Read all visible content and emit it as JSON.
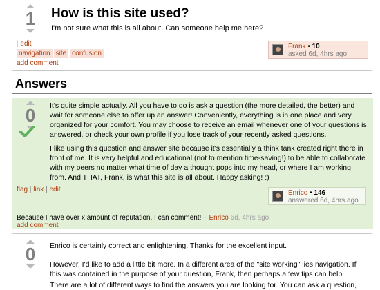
{
  "question": {
    "votes": "1",
    "title": "How is this site used?",
    "body": "I'm not sure what this is all about. Can someone help me here?",
    "menu": {
      "sep": "| ",
      "edit": "edit"
    },
    "tags": [
      "navigation",
      "site",
      "confusion"
    ],
    "add_comment": "add comment",
    "owner": {
      "name": "Frank",
      "dot": " • ",
      "rep": "10",
      "asked": "asked 6d, 4hrs ago"
    }
  },
  "answers_heading": "Answers",
  "answers": [
    {
      "votes": "0",
      "accepted": true,
      "p1": "It's quite simple actually. All you have to do is ask a question (the more detailed, the better) and wait for someone else to offer up an answer! Conveniently, everything is in one place and very organized for your comfort. You may choose to receive an email whenever one of your questions is answered, or check your own profile if you lose track of your recently asked questions.",
      "p2": "I like using this question and answer site because it's essentially a think tank created right there in front of me. It is very helpful and educational (not to mention time-saving!) to be able to collaborate with my peers no matter what time of day a thought pops into my head, or where I am working from. And THAT, Frank, is what this site is all about. Happy asking! :)",
      "menu": {
        "flag": "flag",
        "sep": " | ",
        "link": "link",
        "edit": "edit"
      },
      "owner": {
        "name": "Enrico",
        "dot": " • ",
        "rep": "146",
        "answered": "answered 6d, 4hrs ago"
      },
      "comment": {
        "text": "Because I have over x amount of reputation, I can comment! – ",
        "user": "Enrico",
        "time": " 6d, 4hrs ago"
      },
      "add_comment": "add comment"
    },
    {
      "votes": "0",
      "p1": "Enrico is certainly correct and enlightening. Thanks for the excellent input.",
      "p2": "However, I'd like to add a little bit more. In a different area of the \"site working\" lies navigation. If this was contained in the purpose of your question, Frank, then perhaps a few tips can help.",
      "p3": "There are a lot of different ways to find the answers you are looking for. You can ask a question, which you"
    }
  ],
  "colors": {
    "link": "#b04010",
    "accepted_bg": "#e3f0d8",
    "accepted_check": "#5fb05f",
    "owner_bg": "#fbe6dd"
  },
  "icons": {
    "vote_up": "up-arrow-icon",
    "vote_down": "down-arrow-icon",
    "accepted": "checkmark-icon"
  }
}
